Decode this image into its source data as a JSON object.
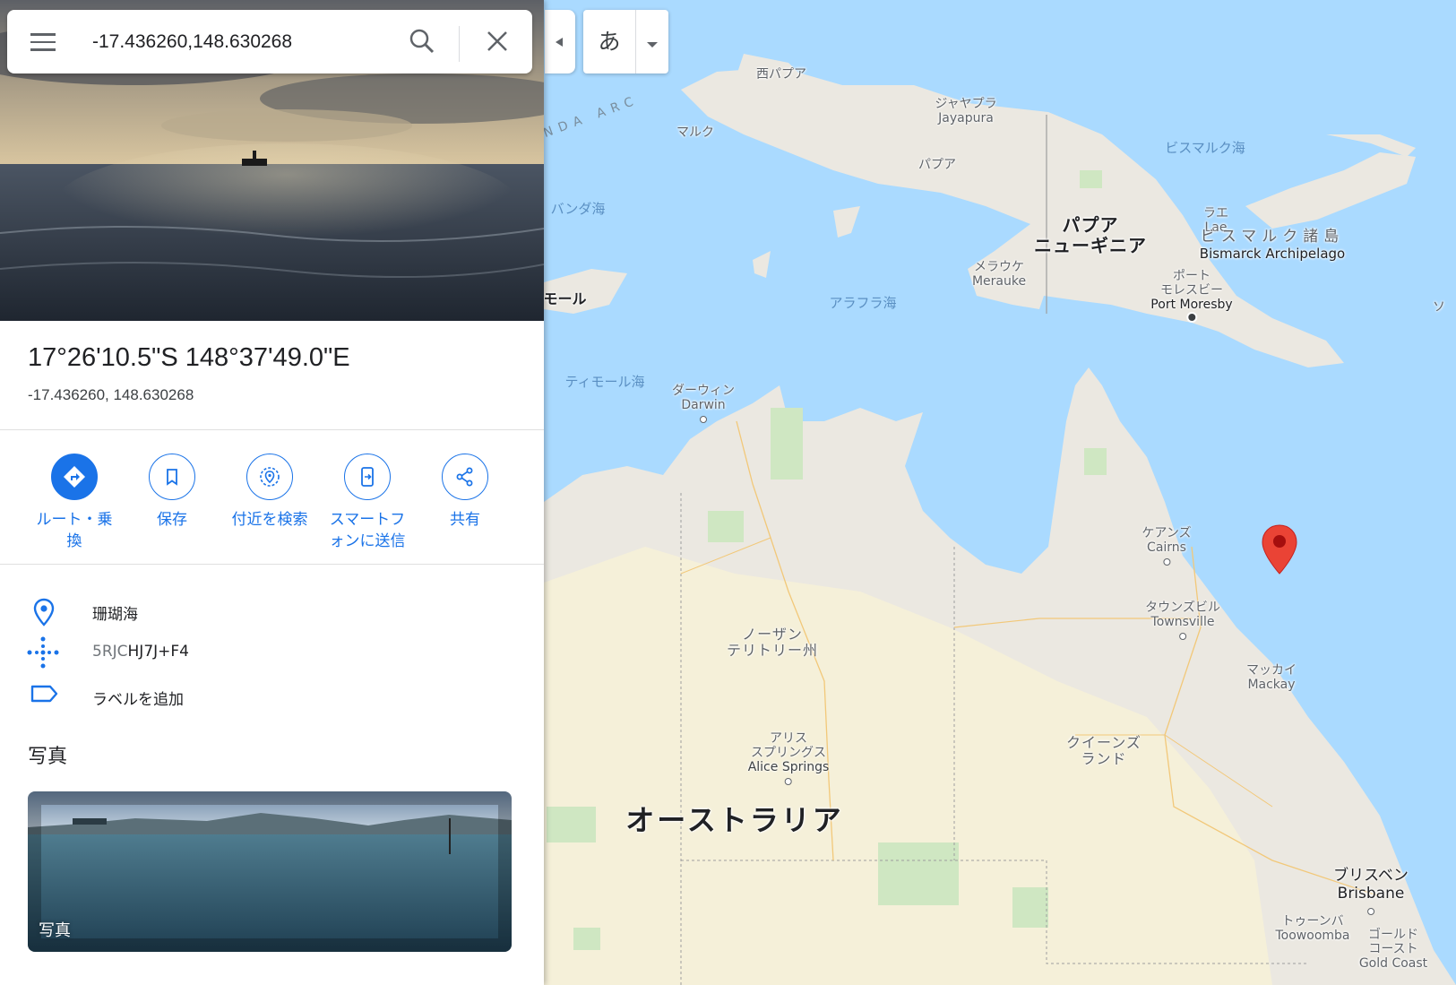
{
  "search": {
    "query": "-17.436260,148.630268"
  },
  "ime": {
    "char": "あ"
  },
  "place": {
    "dms": "17°26'10.5\"S 148°37'49.0\"E",
    "decimal": "-17.436260, 148.630268"
  },
  "actions": [
    {
      "label": "ルート・乗\n換"
    },
    {
      "label": "保存"
    },
    {
      "label": "付近を検索"
    },
    {
      "label": "スマートフ\nォンに送信"
    },
    {
      "label": "共有"
    }
  ],
  "details": {
    "location": "珊瑚海",
    "plus_code_prefix": "5RJC",
    "plus_code": "HJ7J+F4",
    "add_label": "ラベルを追加"
  },
  "photos": {
    "heading": "写真",
    "card_label": "写真"
  },
  "map": {
    "labels": {
      "west_papua": "西パプア",
      "banda_arc": "BANDA ARC",
      "maluku": "マルク",
      "banda_sea": "バンダ海",
      "jayapura_jp": "ジャヤプラ",
      "jayapura": "Jayapura",
      "papua": "パプア",
      "bismarck_sea": "ビスマルク海",
      "lae_jp": "ラエ",
      "lae": "Lae",
      "png_1": "パプア",
      "png_2": "ニューギニア",
      "bismarck_arch_jp": "ビスマルク諸島",
      "bismarck_arch": "Bismarck Archipelago",
      "merauke_jp": "メラウケ",
      "merauke": "Merauke",
      "pm_jp_1": "ポート",
      "pm_jp_2": "モレスビー",
      "pm": "Port Moresby",
      "east_timor": "東ティモール",
      "arafura": "アラフラ海",
      "timor_sea": "ティモール海",
      "darwin_jp": "ダーウィン",
      "darwin": "Darwin",
      "cairns_jp": "ケアンズ",
      "cairns": "Cairns",
      "townsville_jp": "タウンズビル",
      "townsville": "Townsville",
      "nt_1": "ノーザン",
      "nt_2": "テリトリー州",
      "mackay_jp": "マッカイ",
      "mackay": "Mackay",
      "alice_jp_1": "アリス",
      "alice_jp_2": "スプリングス",
      "alice": "Alice Springs",
      "qld_1": "クイーンズ",
      "qld_2": "ランド",
      "australia": "オーストラリア",
      "brisbane_jp": "ブリスベン",
      "brisbane": "Brisbane",
      "toowoomba_jp": "トゥーンバ",
      "toowoomba": "Toowoomba",
      "gc_jp_1": "ゴールド",
      "gc_jp_2": "コースト",
      "gc": "Gold Coast",
      "so": "ソ"
    }
  },
  "colors": {
    "accent": "#1a73e8",
    "water": "#aadaff",
    "land": "#ebe8e1",
    "marker": "#ea4335"
  }
}
